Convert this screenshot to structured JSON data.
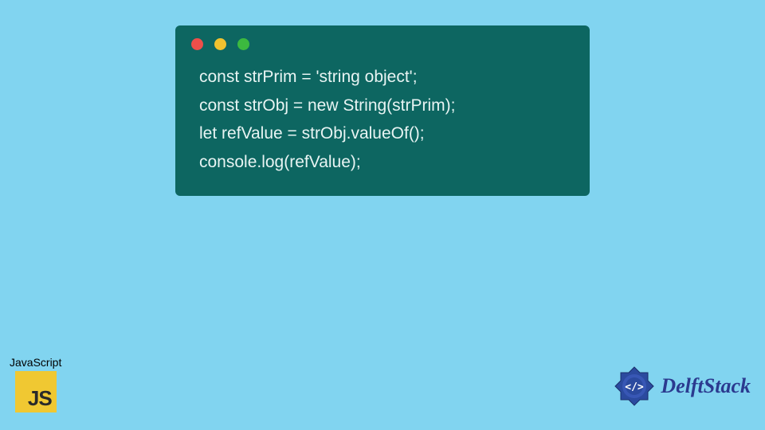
{
  "code": {
    "lines": [
      "const strPrim = 'string object';",
      "const strObj = new String(strPrim);",
      "let refValue = strObj.valueOf();",
      "console.log(refValue);"
    ]
  },
  "badges": {
    "js_label": "JavaScript",
    "js_logo_text": "JS",
    "brand_text": "DelftStack"
  },
  "colors": {
    "background": "#81d4f0",
    "window": "#0d6661",
    "code_text": "#e8f4f3",
    "dot_red": "#ed4f4a",
    "dot_yellow": "#f0c22f",
    "dot_green": "#3cb93f",
    "js_yellow": "#f0c832",
    "brand_blue": "#2b3a8f"
  }
}
